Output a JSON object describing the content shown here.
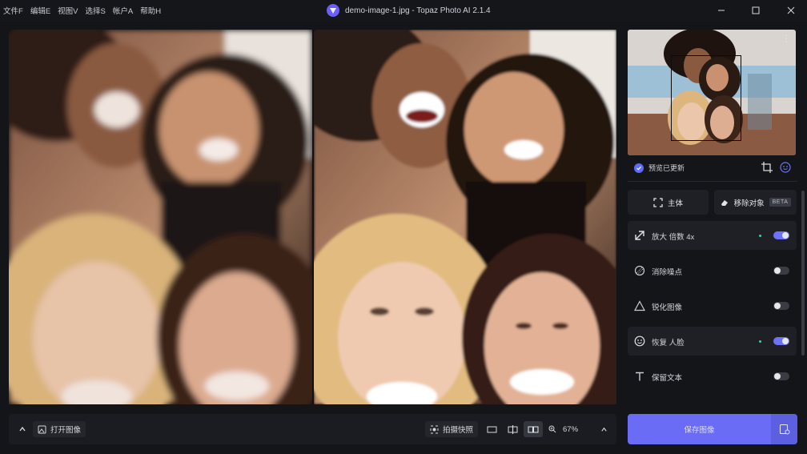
{
  "menu": [
    "文件F",
    "编辑E",
    "视图V",
    "选择S",
    "帐户A",
    "帮助H"
  ],
  "window": {
    "title": "demo-image-1.jpg - Topaz Photo AI 2.1.4"
  },
  "preview": {
    "status": "预览已更新",
    "more": "⋮"
  },
  "modes": {
    "subject": "主体",
    "remove_object": "移除对象",
    "beta": "BETA"
  },
  "features": [
    {
      "label": "放大 倍数 4x",
      "enabled": true,
      "icon": "upscale-icon"
    },
    {
      "label": "消除噪点",
      "enabled": false,
      "icon": "denoise-icon"
    },
    {
      "label": "锐化图像",
      "enabled": false,
      "icon": "sharpen-icon"
    },
    {
      "label": "恢复 人脸",
      "enabled": true,
      "icon": "face-icon"
    },
    {
      "label": "保留文本",
      "enabled": false,
      "icon": "text-icon"
    }
  ],
  "toolbar": {
    "open_image": "打开图像",
    "snapshot": "拍摄快照",
    "zoom": "67%"
  },
  "save": {
    "label": "保存图像"
  },
  "colors": {
    "accent": "#6b6cf5",
    "toggle_on": "#6c74f5",
    "status_dot": "#3ecf8e"
  }
}
